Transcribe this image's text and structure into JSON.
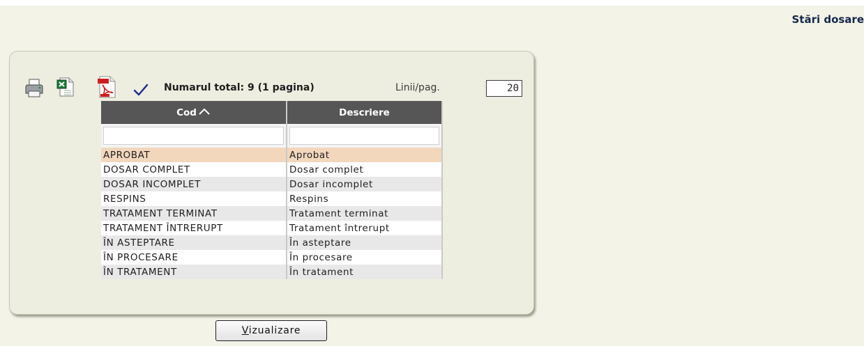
{
  "page": {
    "title": "Stări dosare"
  },
  "toolbar": {
    "icons": [
      "printer-icon",
      "excel-export-icon",
      "pdf-export-icon",
      "checkmark-icon"
    ],
    "total_text": "Numarul total: 9 (1 pagina)",
    "lines_per_page_label": "Linii/pag.",
    "lines_per_page_value": "20"
  },
  "grid": {
    "columns": [
      {
        "label": "Cod",
        "sort": "ascending"
      },
      {
        "label": "Descriere"
      }
    ],
    "rows": [
      {
        "cod": "APROBAT",
        "descriere": "Aprobat",
        "selected": true
      },
      {
        "cod": "DOSAR COMPLET",
        "descriere": "Dosar complet"
      },
      {
        "cod": "DOSAR INCOMPLET",
        "descriere": "Dosar incomplet"
      },
      {
        "cod": "RESPINS",
        "descriere": "Respins"
      },
      {
        "cod": "TRATAMENT TERMINAT",
        "descriere": "Tratament terminat"
      },
      {
        "cod": "TRATAMENT ÎNTRERUPT",
        "descriere": "Tratament întrerupt"
      },
      {
        "cod": "ÎN ASTEPTARE",
        "descriere": "În asteptare"
      },
      {
        "cod": "ÎN PROCESARE",
        "descriere": "În procesare"
      },
      {
        "cod": "ÎN TRATAMENT",
        "descriere": "În tratament"
      }
    ]
  },
  "actions": {
    "view_button": "Vizualizare"
  },
  "colors": {
    "header_bg": "#565656",
    "selected_row": "#f2d7bd",
    "accent_check": "#1a2a8c"
  }
}
